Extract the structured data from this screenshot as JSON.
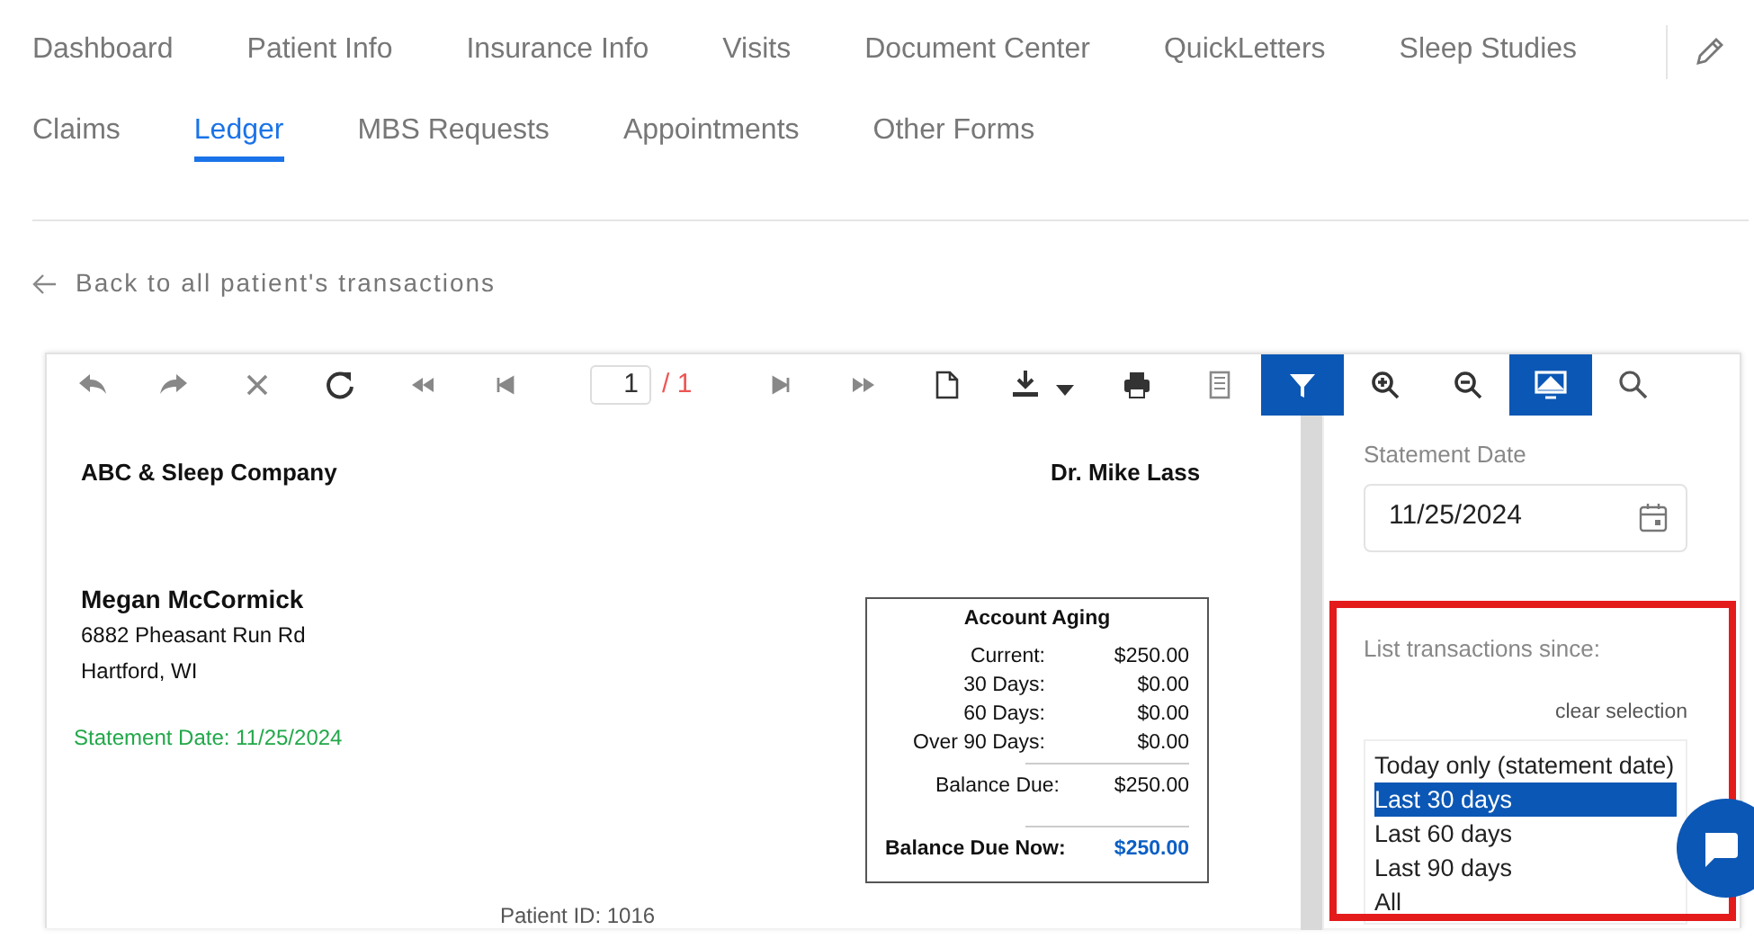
{
  "nav_row_1": [
    {
      "label": "Dashboard",
      "selected": false
    },
    {
      "label": "Patient Info",
      "selected": false
    },
    {
      "label": "Insurance Info",
      "selected": false
    },
    {
      "label": "Visits",
      "selected": false
    },
    {
      "label": "Document Center",
      "selected": false
    },
    {
      "label": "QuickLetters",
      "selected": false
    },
    {
      "label": "Sleep Studies",
      "selected": false
    }
  ],
  "nav_row_2": [
    {
      "label": "Claims",
      "selected": false
    },
    {
      "label": "Ledger",
      "selected": true
    },
    {
      "label": "MBS Requests",
      "selected": false
    },
    {
      "label": "Appointments",
      "selected": false
    },
    {
      "label": "Other Forms",
      "selected": false
    }
  ],
  "back_link": {
    "label": "Back to all patient's transactions"
  },
  "toolbar": [
    {
      "kind": "undo",
      "active": false
    },
    {
      "kind": "redo",
      "active": false
    },
    {
      "kind": "close",
      "active": false
    },
    {
      "kind": "refresh",
      "active": false
    },
    {
      "kind": "rewind",
      "active": false
    },
    {
      "kind": "first",
      "active": false
    },
    {
      "kind": "page",
      "value": "1",
      "total": "/ 1"
    },
    {
      "kind": "last",
      "active": false
    },
    {
      "kind": "fastforward",
      "active": false
    },
    {
      "kind": "document",
      "active": false
    },
    {
      "kind": "download",
      "active": false
    },
    {
      "kind": "print",
      "active": false
    },
    {
      "kind": "copy",
      "active": false
    },
    {
      "kind": "filter",
      "active": true
    },
    {
      "kind": "zoom_in",
      "active": false
    },
    {
      "kind": "zoom_out",
      "active": false
    },
    {
      "kind": "monitor",
      "active": true
    },
    {
      "kind": "search",
      "active": false
    }
  ],
  "report": {
    "company": "ABC & Sleep Company",
    "doctor": "Dr. Mike Lass",
    "patient_name": "Megan McCormick",
    "address_lines": [
      "6882 Pheasant Run Rd",
      "Hartford, WI"
    ],
    "statement_date": "Statement Date: 11/25/2024",
    "account_aging": {
      "title": "Account Aging",
      "rows": [
        {
          "label": "Current:",
          "value": "$250.00"
        },
        {
          "label": "30 Days:",
          "value": "$0.00"
        },
        {
          "label": "60 Days:",
          "value": "$0.00"
        },
        {
          "label": "Over 90 Days:",
          "value": "$0.00"
        }
      ],
      "balance_due": {
        "label": "Balance Due:",
        "value": "$250.00"
      },
      "balance_due_now": {
        "label": "Balance Due Now:",
        "value": "$250.00"
      }
    },
    "patient_id": "Patient ID: 1016"
  },
  "side_panel": {
    "date_label": "Statement Date",
    "date_value": "11/25/2024",
    "since_label": "List transactions since:",
    "clear_link": "clear selection",
    "options": [
      {
        "label": "Today only (statement date)",
        "selected": false
      },
      {
        "label": "Last 30 days",
        "selected": true
      },
      {
        "label": "Last 60 days",
        "selected": false
      },
      {
        "label": "Last 90 days",
        "selected": false
      },
      {
        "label": "All",
        "selected": false
      }
    ]
  }
}
